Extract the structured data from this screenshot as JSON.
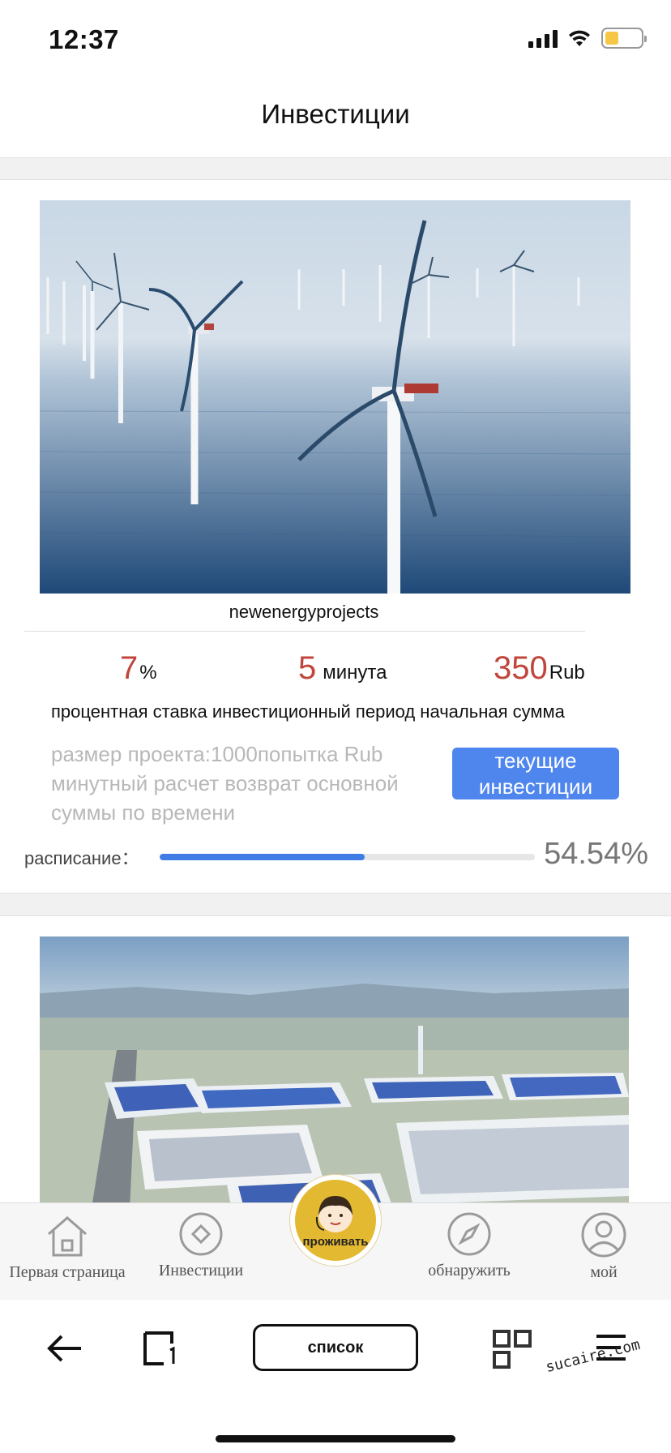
{
  "status_bar": {
    "time": "12:37"
  },
  "page": {
    "title": "Инвестиции"
  },
  "projects": [
    {
      "image": "wind-turbines-photo",
      "name": "newenergyprojects",
      "rate": {
        "value": "7",
        "unit": "%"
      },
      "period": {
        "value": "5",
        "unit": "минута"
      },
      "start_amount": {
        "value": "350",
        "unit": "Rub"
      },
      "labels": "процентная ставка инвестиционный период начальная сумма",
      "description": "размер проекта:1000попытка Rub минутный расчет возврат основной суммы по времени",
      "button_label": "текущие инвестиции",
      "progress_label": "расписание：",
      "progress_percent": 54.54,
      "progress_text": "54.54%"
    },
    {
      "image": "solar-industrial-park-photo"
    }
  ],
  "tabbar": {
    "home": "Первая страница",
    "invest": "Инвестиции",
    "live": "проживать",
    "discover": "обнаружить",
    "mine": "мой"
  },
  "browser": {
    "list_label": "список",
    "watermark_text": "sucaire.com"
  },
  "colors": {
    "accent_blue": "#4f86ee",
    "value_red": "#c0463d",
    "live_gold": "#e3b931"
  }
}
